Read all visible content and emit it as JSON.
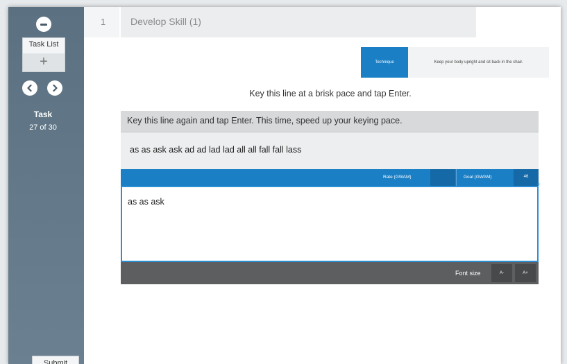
{
  "sidebar": {
    "collapse_icon": "minus-icon",
    "task_list_label": "Task List",
    "task_list_add_icon": "plus-icon",
    "add_symbol": "+",
    "prev_icon": "chevron-left-icon",
    "next_icon": "chevron-right-icon",
    "task_label": "Task",
    "task_count": "27 of 30",
    "submit_label": "Submit"
  },
  "header": {
    "step_number": "1",
    "title": "Develop Skill (1)"
  },
  "technique": {
    "label": "Technique",
    "tip": "Keep your body upright and sit back in the chair."
  },
  "instruction": "Key this line at a brisk pace and tap Enter.",
  "prompt": {
    "header_text": "Key this line again and tap Enter. This time, speed up your keying pace.",
    "source_line": "as as ask ask ad ad lad lad all all fall fall lass"
  },
  "stats": {
    "rate_label": "Rate (GWAM)",
    "rate_value": "",
    "goal_label": "Goal (GWAM)",
    "goal_value": "46"
  },
  "typing": {
    "value": "as as ask"
  },
  "font_controls": {
    "label": "Font size",
    "decrease": "A-",
    "increase": "A+"
  },
  "colors": {
    "accent": "#1a7fc5",
    "sidebar": "#5b7181",
    "font_bar": "#5c5e60"
  }
}
